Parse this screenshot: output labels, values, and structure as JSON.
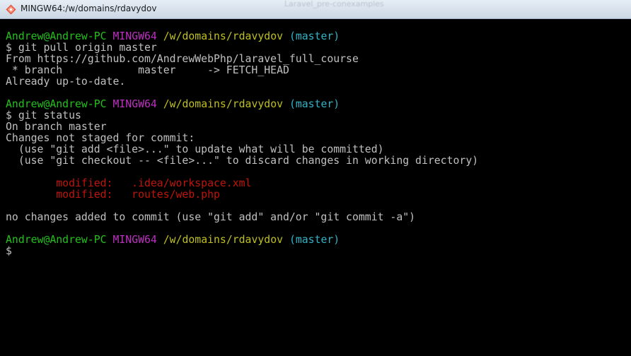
{
  "window": {
    "title": "MINGW64:/w/domains/rdavydov",
    "background_text": "Laravel_pre-conexamples",
    "app_icon": "git-bash-diamond-icon"
  },
  "colors": {
    "background": "#000000",
    "text": "#c0c0c0",
    "user": "#23c01c",
    "host": "#bd2fc0",
    "path": "#bfbf20",
    "branch": "#2fb4c8",
    "modified": "#c0140c"
  },
  "prompt": {
    "user": "Andrew@Andrew-PC",
    "host": "MINGW64",
    "path": "/w/domains/rdavydov",
    "branch": "(master)",
    "symbol": "$"
  },
  "terminal": {
    "cmd1": "$ git pull origin master",
    "out1_1": "From https://github.com/AndrewWebPhp/laravel_full_course",
    "out1_2": " * branch            master     -> FETCH_HEAD",
    "out1_3": "Already up-to-date.",
    "cmd2": "$ git status",
    "out2_1": "On branch master",
    "out2_2": "Changes not staged for commit:",
    "out2_3": "  (use \"git add <file>...\" to update what will be committed)",
    "out2_4": "  (use \"git checkout -- <file>...\" to discard changes in working directory)",
    "modified_1": "        modified:   .idea/workspace.xml",
    "modified_2": "        modified:   routes/web.php",
    "out2_5": "no changes added to commit (use \"git add\" and/or \"git commit -a\")",
    "cursor_prompt": "$"
  }
}
